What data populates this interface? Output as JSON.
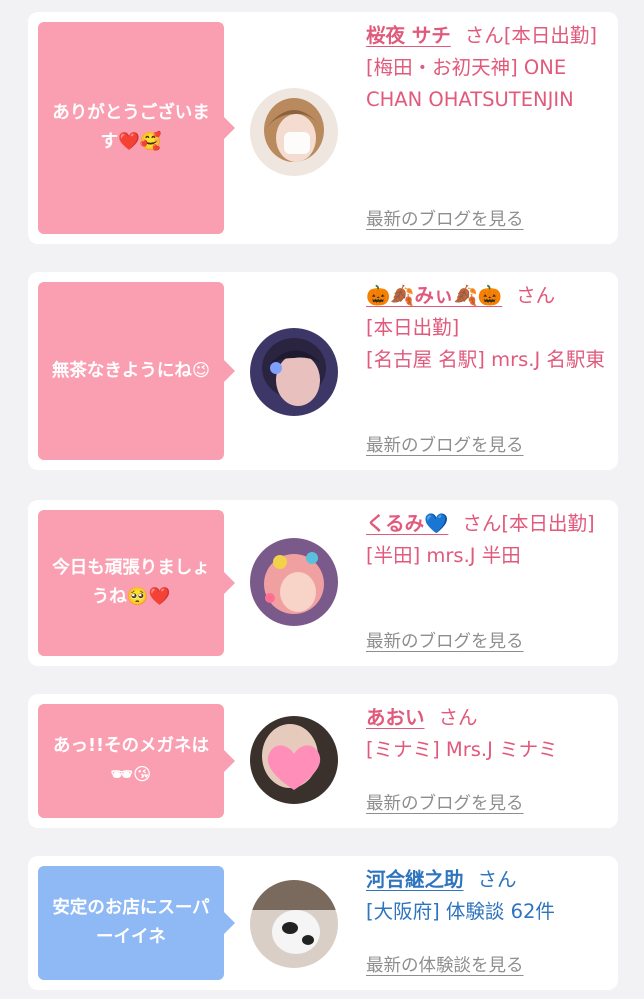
{
  "items": [
    {
      "message": "ありがとうございます❤️🥰",
      "name": "桜夜 サチ",
      "honorific": "さん",
      "status": "[本日出勤]",
      "shop": "[梅田・お初天神] ONE CHAN OHATSUTENJIN",
      "link": "最新のブログを見る",
      "avatar_icon": "girl-photo-avatar"
    },
    {
      "message": "無茶なきようにね😉",
      "name": "🎃🍂みぃ🍂🎃",
      "honorific": "さん",
      "status": "[本日出勤]",
      "shop": "[名古屋 名駅] mrs.J 名駅東",
      "link": "最新のブログを見る",
      "avatar_icon": "girl-photo-avatar"
    },
    {
      "message": "今日も頑張りましょうね🥺❤️",
      "name": "くるみ💙",
      "honorific": "さん",
      "status": "[本日出勤]",
      "shop": "[半田] mrs.J 半田",
      "link": "最新のブログを見る",
      "avatar_icon": "girl-photo-avatar"
    },
    {
      "message": "あっ!!そのメガネは🕶😘",
      "name": "あおい",
      "honorific": "さん",
      "status": "",
      "shop": "[ミナミ] Mrs.J ミナミ",
      "link": "最新のブログを見る",
      "avatar_icon": "heart-photo-avatar"
    },
    {
      "message": "安定のお店にスーパーイイネ",
      "name": "河合継之助",
      "honorific": "さん",
      "status": "",
      "shop": "[大阪府] 体験談 62件",
      "link": "最新の体験談を見る",
      "avatar_icon": "animal-photo-avatar"
    }
  ],
  "colors": {
    "pink_bubble": "#fa9fb1",
    "blue_bubble": "#8fb9f4",
    "pink_text": "#e15a7c",
    "blue_text": "#2e74be",
    "link_gray": "#8e8e8e"
  }
}
